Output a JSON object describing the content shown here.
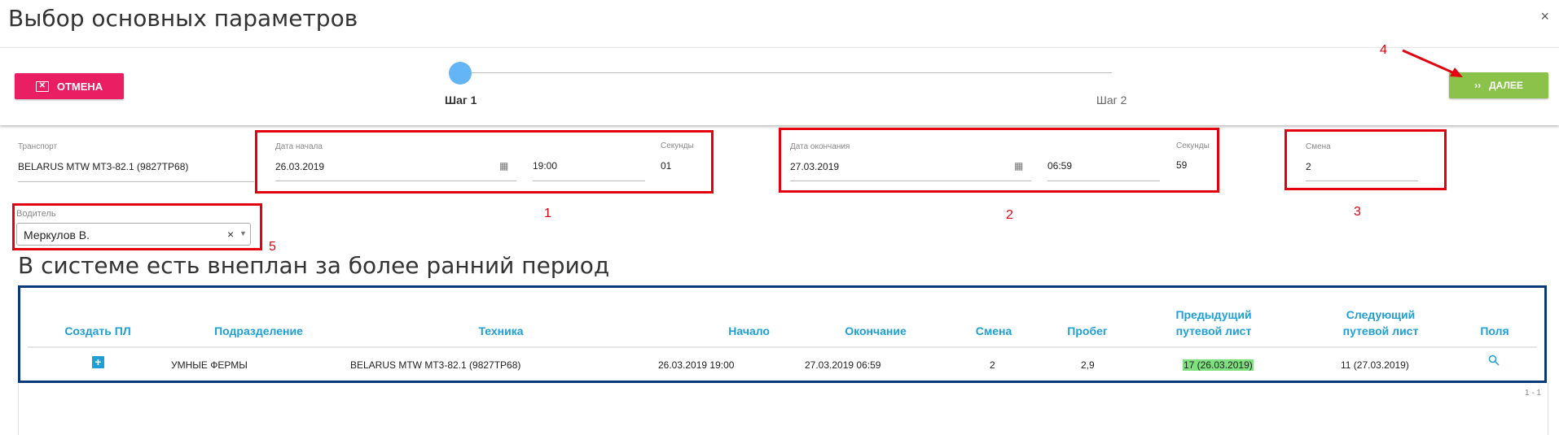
{
  "dialog": {
    "title": "Выбор основных параметров",
    "close_glyph": "×"
  },
  "toolbar": {
    "cancel_label": "ОТМЕНА",
    "next_label": "ДАЛЕЕ",
    "next_glyph": "››"
  },
  "stepper": {
    "step1": "Шаг 1",
    "step2": "Шаг 2",
    "current": 1
  },
  "form": {
    "transport": {
      "label": "Транспорт",
      "value": "BELARUS MTW MT3-82.1 (9827TP68)"
    },
    "start": {
      "label": "Дата начала",
      "date": "26.03.2019",
      "time": "19:00",
      "seconds_label": "Секунды",
      "seconds": "01"
    },
    "end": {
      "label": "Дата окончания",
      "date": "27.03.2019",
      "time": "06:59",
      "seconds_label": "Секунды",
      "seconds": "59"
    },
    "shift": {
      "label": "Смена",
      "value": "2"
    },
    "driver": {
      "label": "Водитель",
      "value": "Меркулов В."
    }
  },
  "annotations": {
    "n1": "1",
    "n2": "2",
    "n3": "3",
    "n4": "4",
    "n5": "5"
  },
  "section_title": "В системе есть внеплан за более ранний период",
  "table": {
    "headers": {
      "create": "Создать ПЛ",
      "division": "Подразделение",
      "vehicle": "Техника",
      "start": "Начало",
      "end": "Окончание",
      "shift": "Смена",
      "mileage": "Пробег",
      "prev_line1": "Предыдущий",
      "prev_line2": "путевой лист",
      "next_line1": "Следующий",
      "next_line2": "путевой лист",
      "fields": "Поля"
    },
    "row": {
      "division": "УМНЫЕ ФЕРМЫ",
      "vehicle": "BELARUS MTW MT3-82.1 (9827TP68)",
      "start": "26.03.2019 19:00",
      "end": "27.03.2019 06:59",
      "shift": "2",
      "mileage": "2,9",
      "prev": "17 (26.03.2019)",
      "next": "11 (27.03.2019)"
    },
    "pager": "1 - 1"
  },
  "colors": {
    "cancel": "#e91e63",
    "next": "#8bc34a",
    "accent": "#1e9fd6",
    "annotation": "#e3000f",
    "highlight": "#7ee07e",
    "table_border": "#0a3a7a"
  }
}
